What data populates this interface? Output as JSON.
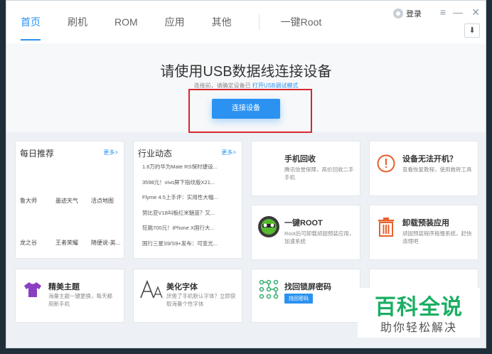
{
  "tabs": [
    "首页",
    "刷机",
    "ROM",
    "应用",
    "其他",
    "一键Root"
  ],
  "user": {
    "login_label": "登录"
  },
  "window": {
    "menu_icon": "≡",
    "min_icon": "—",
    "close_icon": "✕",
    "download_icon": "⬇"
  },
  "hero": {
    "title": "请使用USB数据线连接设备",
    "sub_prefix": "连接前，请确定设备已",
    "sub_link": "打开USB调试模式",
    "connect_label": "连接设备"
  },
  "daily": {
    "title": "每日推荐",
    "more": "更多>",
    "apps": [
      "鲁大师",
      "墨迹天气",
      "活点地图",
      "龙之谷",
      "王者荣耀",
      "随便说-英..."
    ]
  },
  "news": {
    "title": "行业动态",
    "more": "更多>",
    "items": [
      "1.6万的华为Mate RS保时捷设...",
      "3598元！vivo屏下指纹版X21...",
      "Flyme 4.5上手评：实用性大幅...",
      "努比亚V18叫板红米魅蓝？又...",
      "狂跳700元！iPhone X国行大...",
      "国行三星S9/S9+发布：可变光..."
    ]
  },
  "features": [
    {
      "title": "手机回收",
      "desc": "腾讯信誉保障，高价回收二手手机"
    },
    {
      "title": "设备无法开机？",
      "desc": "查看恢复教程，使用救砖工具"
    },
    {
      "title": "一键ROOT",
      "desc": "Root后可卸载顽固预装应用，加速系统"
    },
    {
      "title": "卸载预装应用",
      "desc": "顽固预装程序拖慢系统，赶快清理吧"
    },
    {
      "title": "精美主题",
      "desc": "海量主题一键更换，每天都用新手机"
    },
    {
      "title": "美化字体",
      "desc": "厌倦了手机默认字体？立即获取海量个性字体"
    },
    {
      "title": "找回锁屏密码",
      "desc": "",
      "button": "找回密码"
    }
  ],
  "watermark": {
    "line1": "百科全说",
    "line2": "助你轻松解决"
  },
  "colors": {
    "accent": "#2b92f1",
    "highlight_box": "#d9272e",
    "watermark_green": "#1aae62"
  }
}
